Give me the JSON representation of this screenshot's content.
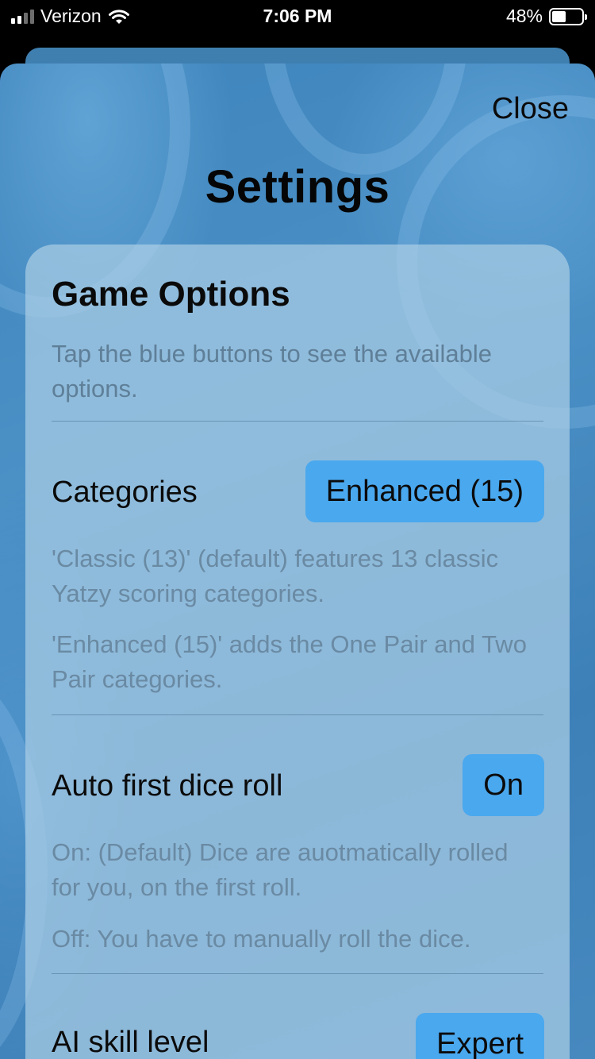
{
  "status_bar": {
    "carrier": "Verizon",
    "time": "7:06 PM",
    "battery_percent": "48%",
    "battery_level": 0.48,
    "signal_bars": 4,
    "signal_bars_active": 2,
    "icons": [
      "signal-icon",
      "wifi-icon",
      "battery-icon"
    ]
  },
  "header": {
    "close_label": "Close",
    "title": "Settings"
  },
  "card": {
    "title": "Game Options",
    "description": "Tap the blue buttons to see the available options."
  },
  "options": {
    "categories": {
      "label": "Categories",
      "value": "Enhanced (15)",
      "help": [
        "'Classic (13)' (default) features 13 classic Yatzy scoring categories.",
        "'Enhanced (15)' adds the One Pair and Two Pair categories."
      ]
    },
    "auto_roll": {
      "label": "Auto first dice roll",
      "value": "On",
      "help": [
        "On: (Default) Dice are auotmatically rolled for you, on the first roll.",
        "Off: You have to manually roll the dice."
      ]
    },
    "ai_skill": {
      "label": "AI skill level",
      "value": "Expert"
    }
  },
  "colors": {
    "accent_button": "#4aa8ee",
    "background_blue": "#4689bf",
    "card": "#aacde4",
    "help_text": "#6a8aa3"
  }
}
